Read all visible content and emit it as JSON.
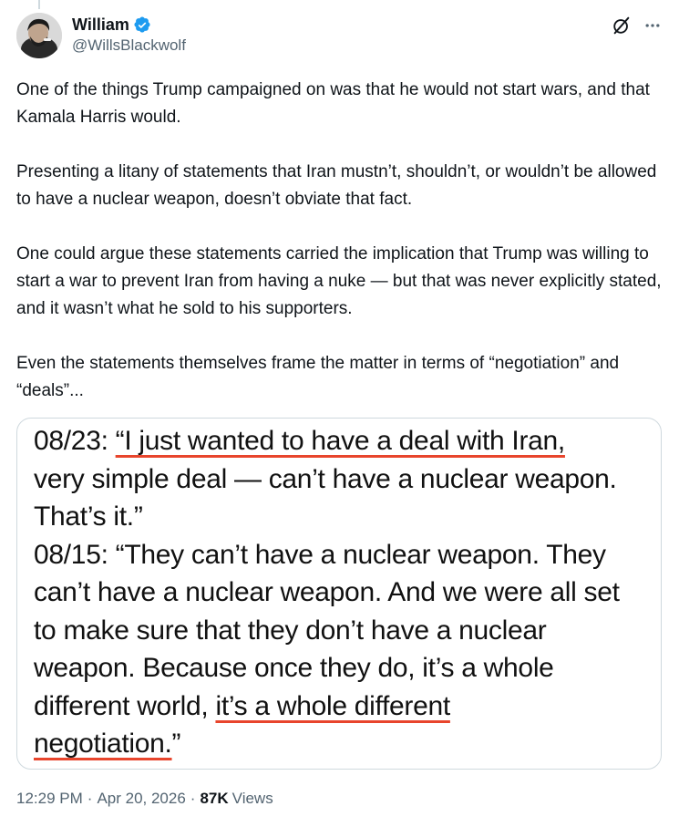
{
  "author": {
    "display_name": "William",
    "handle": "@WillsBlackwolf",
    "verified": true,
    "icons": {
      "avatar": "avatar",
      "verified": "verified-badge-icon",
      "grok": "grok-icon",
      "more": "more-icon"
    }
  },
  "tweet": {
    "paragraphs": [
      "One of the things Trump campaigned on was that he would not start wars, and that Kamala Harris would.",
      "Presenting a litany of statements that Iran mustn’t, shouldn’t, or wouldn’t be allowed to have a nuclear weapon, doesn’t obviate that fact.",
      "One could argue these statements carried the implication that Trump was willing to start a war to prevent Iran from having a nuke — but that was never explicitly stated, and it wasn’t what he sold to his supporters.",
      "Even the statements themselves frame the matter in terms of “negotiation” and “deals”..."
    ]
  },
  "media": {
    "lines": [
      {
        "pre": "08/23: ",
        "underlined": "“I just wanted to have a deal with Iran,",
        "post": ""
      },
      {
        "pre": "very simple deal — can’t have a nuclear weapon.",
        "underlined": "",
        "post": ""
      },
      {
        "pre": "That’s it.”",
        "underlined": "",
        "post": ""
      },
      {
        "pre": "08/15: “They can’t have a nuclear weapon. They",
        "underlined": "",
        "post": ""
      },
      {
        "pre": "can’t have a nuclear weapon. And we were all set",
        "underlined": "",
        "post": ""
      },
      {
        "pre": "to make sure that they don’t have a nuclear",
        "underlined": "",
        "post": ""
      },
      {
        "pre": "weapon. Because once they do, it’s a whole",
        "underlined": "",
        "post": ""
      },
      {
        "pre": "different world, ",
        "underlined": "it’s a whole different",
        "post": ""
      },
      {
        "pre": "",
        "underlined": "negotiation.",
        "post": "”"
      }
    ],
    "underline_color": "#e8452c"
  },
  "meta": {
    "time": "12:29 PM",
    "separator": "·",
    "date": "Apr 20, 2026",
    "views_count": "87K",
    "views_label": "Views"
  },
  "colors": {
    "text": "#0f1419",
    "secondary": "#536471",
    "verified_blue": "#1d9bf0",
    "border": "#cfd9de"
  }
}
